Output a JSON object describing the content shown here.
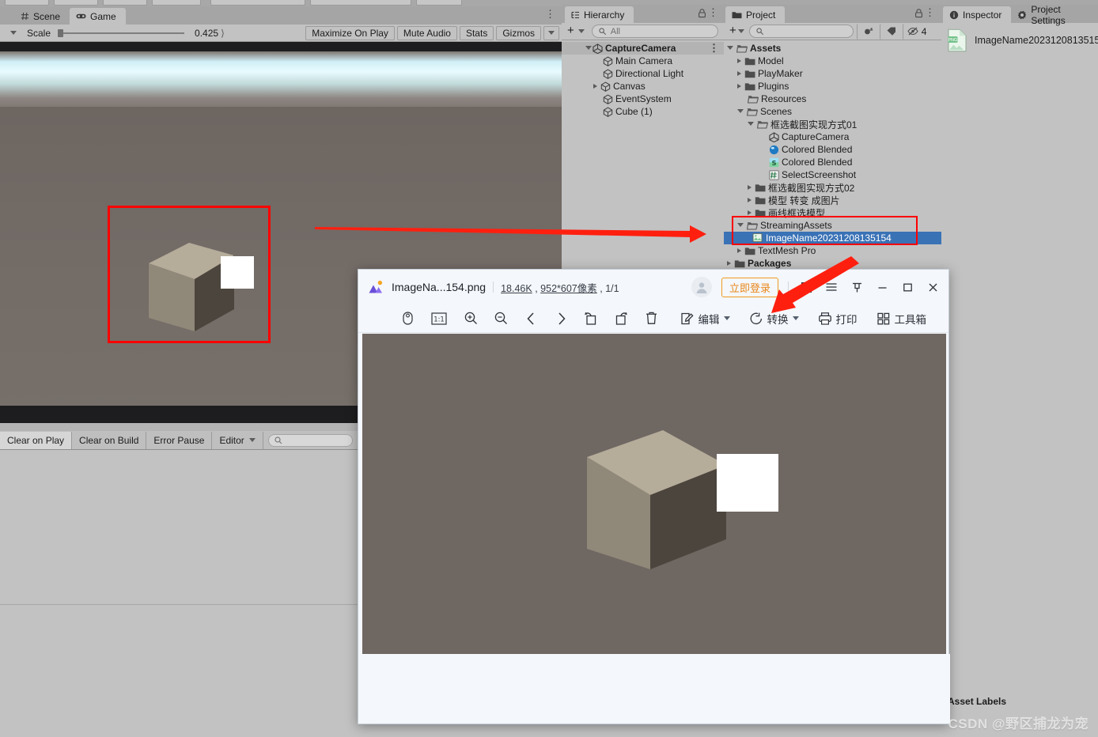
{
  "app": "Unity Editor",
  "top_toolbar": {
    "visible_partial": true
  },
  "game_panel": {
    "tabs": [
      {
        "label": "Scene",
        "icon": "grid-icon",
        "active": false
      },
      {
        "label": "Game",
        "icon": "gamepad-icon",
        "active": true
      }
    ],
    "menu_icon": "kebab-menu-icon",
    "toolbar": {
      "aspect_dropdown_icon": "chevron-down-icon",
      "scale_label": "Scale",
      "scale_value": "0.425",
      "maximize_on_play": "Maximize On Play",
      "mute_audio": "Mute Audio",
      "stats": "Stats",
      "gizmos": "Gizmos",
      "gizmos_caret_icon": "chevron-down-icon"
    },
    "selection_box_color": "#ff0000"
  },
  "console_panel": {
    "buttons": [
      "Clear on Play",
      "Clear on Build",
      "Error Pause",
      "Editor"
    ],
    "editor_caret_icon": "chevron-down-icon",
    "search_placeholder": ""
  },
  "hierarchy": {
    "tab_label": "Hierarchy",
    "tab_icon": "hierarchy-icon",
    "lock_icon": "lock-icon",
    "menu_icon": "kebab-menu-icon",
    "add_label": "+",
    "search_placeholder": "All",
    "items": [
      {
        "label": "CaptureCamera",
        "depth": 0,
        "icon": "unity-scene-icon",
        "expanded": true,
        "bold": true,
        "selected": true,
        "kebab": true
      },
      {
        "label": "Main Camera",
        "depth": 1,
        "icon": "gameobject-icon",
        "expanded": null
      },
      {
        "label": "Directional Light",
        "depth": 1,
        "icon": "gameobject-icon",
        "expanded": null
      },
      {
        "label": "Canvas",
        "depth": 1,
        "icon": "gameobject-icon",
        "expanded": false
      },
      {
        "label": "EventSystem",
        "depth": 1,
        "icon": "gameobject-icon",
        "expanded": null
      },
      {
        "label": "Cube (1)",
        "depth": 1,
        "icon": "gameobject-icon",
        "expanded": null
      }
    ]
  },
  "project": {
    "tab_label": "Project",
    "tab_icon": "folder-icon",
    "lock_icon": "lock-icon",
    "menu_icon": "kebab-menu-icon",
    "add_label": "+",
    "search_placeholder": "",
    "toolbar_icons": [
      "save-filter-icon",
      "label-icon",
      "hidden-eye-icon"
    ],
    "hidden_count": "4",
    "items": [
      {
        "label": "Assets",
        "depth": 0,
        "icon": "folder-open-icon",
        "expanded": true,
        "bold": true
      },
      {
        "label": "Model",
        "depth": 1,
        "icon": "folder-icon",
        "expanded": false
      },
      {
        "label": "PlayMaker",
        "depth": 1,
        "icon": "folder-icon",
        "expanded": false
      },
      {
        "label": "Plugins",
        "depth": 1,
        "icon": "folder-icon",
        "expanded": false
      },
      {
        "label": "Resources",
        "depth": 1,
        "icon": "folder-open-icon",
        "expanded": null
      },
      {
        "label": "Scenes",
        "depth": 1,
        "icon": "folder-open-icon",
        "expanded": true
      },
      {
        "label": "框选截图实现方式01",
        "depth": 2,
        "icon": "folder-open-icon",
        "expanded": true
      },
      {
        "label": "CaptureCamera",
        "depth": 3,
        "icon": "unity-scene-icon",
        "expanded": null
      },
      {
        "label": "Colored Blended",
        "depth": 3,
        "icon": "material-icon",
        "expanded": null
      },
      {
        "label": "Colored Blended",
        "depth": 3,
        "icon": "shader-icon",
        "expanded": null
      },
      {
        "label": "SelectScreenshot",
        "depth": 3,
        "icon": "script-icon",
        "expanded": null
      },
      {
        "label": "框选截图实现方式02",
        "depth": 2,
        "icon": "folder-icon",
        "expanded": false
      },
      {
        "label": "模型 转变 成图片",
        "depth": 2,
        "icon": "folder-icon",
        "expanded": false
      },
      {
        "label": "画线框选模型",
        "depth": 2,
        "icon": "folder-icon",
        "expanded": false
      },
      {
        "label": "StreamingAssets",
        "depth": 1,
        "icon": "folder-open-icon",
        "expanded": true
      },
      {
        "label": "ImageName20231208135154",
        "depth": 2,
        "icon": "png-image-icon",
        "expanded": null,
        "selected": true
      },
      {
        "label": "TextMesh Pro",
        "depth": 1,
        "icon": "folder-icon",
        "expanded": false
      },
      {
        "label": "Packages",
        "depth": 0,
        "icon": "folder-icon",
        "expanded": false,
        "bold": true
      }
    ],
    "highlight_box_color": "#ff0000"
  },
  "inspector": {
    "tabs": [
      {
        "label": "Inspector",
        "icon": "info-icon",
        "active": true
      },
      {
        "label": "Project Settings",
        "icon": "gear-icon",
        "active": false
      }
    ],
    "asset_name": "ImageName2023120813515",
    "asset_icon": "png-file-icon",
    "asset_labels_title": "Asset Labels"
  },
  "viewer": {
    "logo_icon": "photo-viewer-logo-icon",
    "file_name": "ImageNa...154.png",
    "file_size": "18.46K",
    "dimensions": "952*607像素",
    "page_index": "1/1",
    "avatar_icon": "user-avatar-icon",
    "login_label": "立即登录",
    "window_icons": [
      "fullscreen-icon",
      "hamburger-menu-icon",
      "pin-icon",
      "minimize-icon",
      "maximize-icon",
      "close-icon"
    ],
    "toolbar_left": [
      {
        "name": "mouse-mode-icon",
        "label": ""
      },
      {
        "name": "actual-size-icon",
        "label": "1:1"
      },
      {
        "name": "zoom-in-icon",
        "label": ""
      },
      {
        "name": "zoom-out-icon",
        "label": ""
      },
      {
        "name": "previous-image-icon",
        "label": ""
      },
      {
        "name": "next-image-icon",
        "label": ""
      },
      {
        "name": "rotate-left-icon",
        "label": ""
      },
      {
        "name": "rotate-right-icon",
        "label": ""
      },
      {
        "name": "delete-icon",
        "label": ""
      }
    ],
    "toolbar_right": [
      {
        "name": "edit-icon",
        "label": "编辑",
        "caret": true
      },
      {
        "name": "convert-icon",
        "label": "转换",
        "caret": true
      },
      {
        "name": "print-icon",
        "label": "打印",
        "caret": false
      },
      {
        "name": "toolbox-icon",
        "label": "工具箱",
        "caret": false
      }
    ],
    "canvas_bg": "#6f6762"
  },
  "watermark": "CSDN @野区捕龙为宠",
  "colors": {
    "unity_bg": "#c2c2c2",
    "unity_tabbar": "#a5a5a5",
    "selection_blue": "#3a72b6",
    "annotation_red": "#ff0000",
    "viewer_bg": "#f4f7fb",
    "login_orange": "#e8871a"
  }
}
